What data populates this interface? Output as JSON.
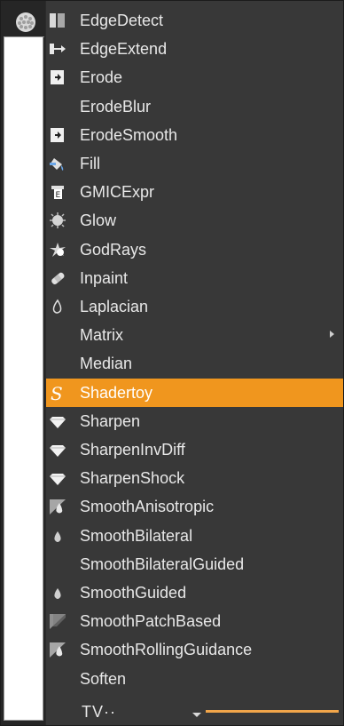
{
  "colors": {
    "menu_bg": "#383838",
    "highlight": "#f0961e",
    "text": "#e8e8e8",
    "selected_text": "#ffffff"
  },
  "toolbar": {
    "node_icon": "node-gear-icon"
  },
  "menu": {
    "selected_index": 13,
    "items": [
      {
        "label": "EdgeDetect",
        "icon": "edge-detect-icon",
        "has_submenu": false
      },
      {
        "label": "EdgeExtend",
        "icon": "edge-extend-icon",
        "has_submenu": false
      },
      {
        "label": "Erode",
        "icon": "erode-icon",
        "has_submenu": false
      },
      {
        "label": "ErodeBlur",
        "icon": "",
        "has_submenu": false
      },
      {
        "label": "ErodeSmooth",
        "icon": "erode-smooth-icon",
        "has_submenu": false
      },
      {
        "label": "Fill",
        "icon": "fill-bucket-icon",
        "has_submenu": false
      },
      {
        "label": "GMICExpr",
        "icon": "gmic-icon",
        "has_submenu": false
      },
      {
        "label": "Glow",
        "icon": "glow-icon",
        "has_submenu": false
      },
      {
        "label": "GodRays",
        "icon": "godrays-icon",
        "has_submenu": false
      },
      {
        "label": "Inpaint",
        "icon": "bandage-icon",
        "has_submenu": false
      },
      {
        "label": "Laplacian",
        "icon": "laplacian-icon",
        "has_submenu": false
      },
      {
        "label": "Matrix",
        "icon": "",
        "has_submenu": true
      },
      {
        "label": "Median",
        "icon": "",
        "has_submenu": false
      },
      {
        "label": "Shadertoy",
        "icon": "shadertoy-icon",
        "has_submenu": false
      },
      {
        "label": "Sharpen",
        "icon": "diamond-icon",
        "has_submenu": false
      },
      {
        "label": "SharpenInvDiff",
        "icon": "diamond-icon",
        "has_submenu": false
      },
      {
        "label": "SharpenShock",
        "icon": "diamond-icon",
        "has_submenu": false
      },
      {
        "label": "SmoothAnisotropic",
        "icon": "smooth-anisotropic-icon",
        "has_submenu": false
      },
      {
        "label": "SmoothBilateral",
        "icon": "drop-icon",
        "has_submenu": false
      },
      {
        "label": "SmoothBilateralGuided",
        "icon": "",
        "has_submenu": false
      },
      {
        "label": "SmoothGuided",
        "icon": "drop-icon",
        "has_submenu": false
      },
      {
        "label": "SmoothPatchBased",
        "icon": "smooth-patch-icon",
        "has_submenu": false
      },
      {
        "label": "SmoothRollingGuidance",
        "icon": "smooth-anisotropic-icon",
        "has_submenu": false
      },
      {
        "label": "Soften",
        "icon": "",
        "has_submenu": false
      }
    ]
  },
  "bottom": {
    "partial_label": "TV··"
  }
}
